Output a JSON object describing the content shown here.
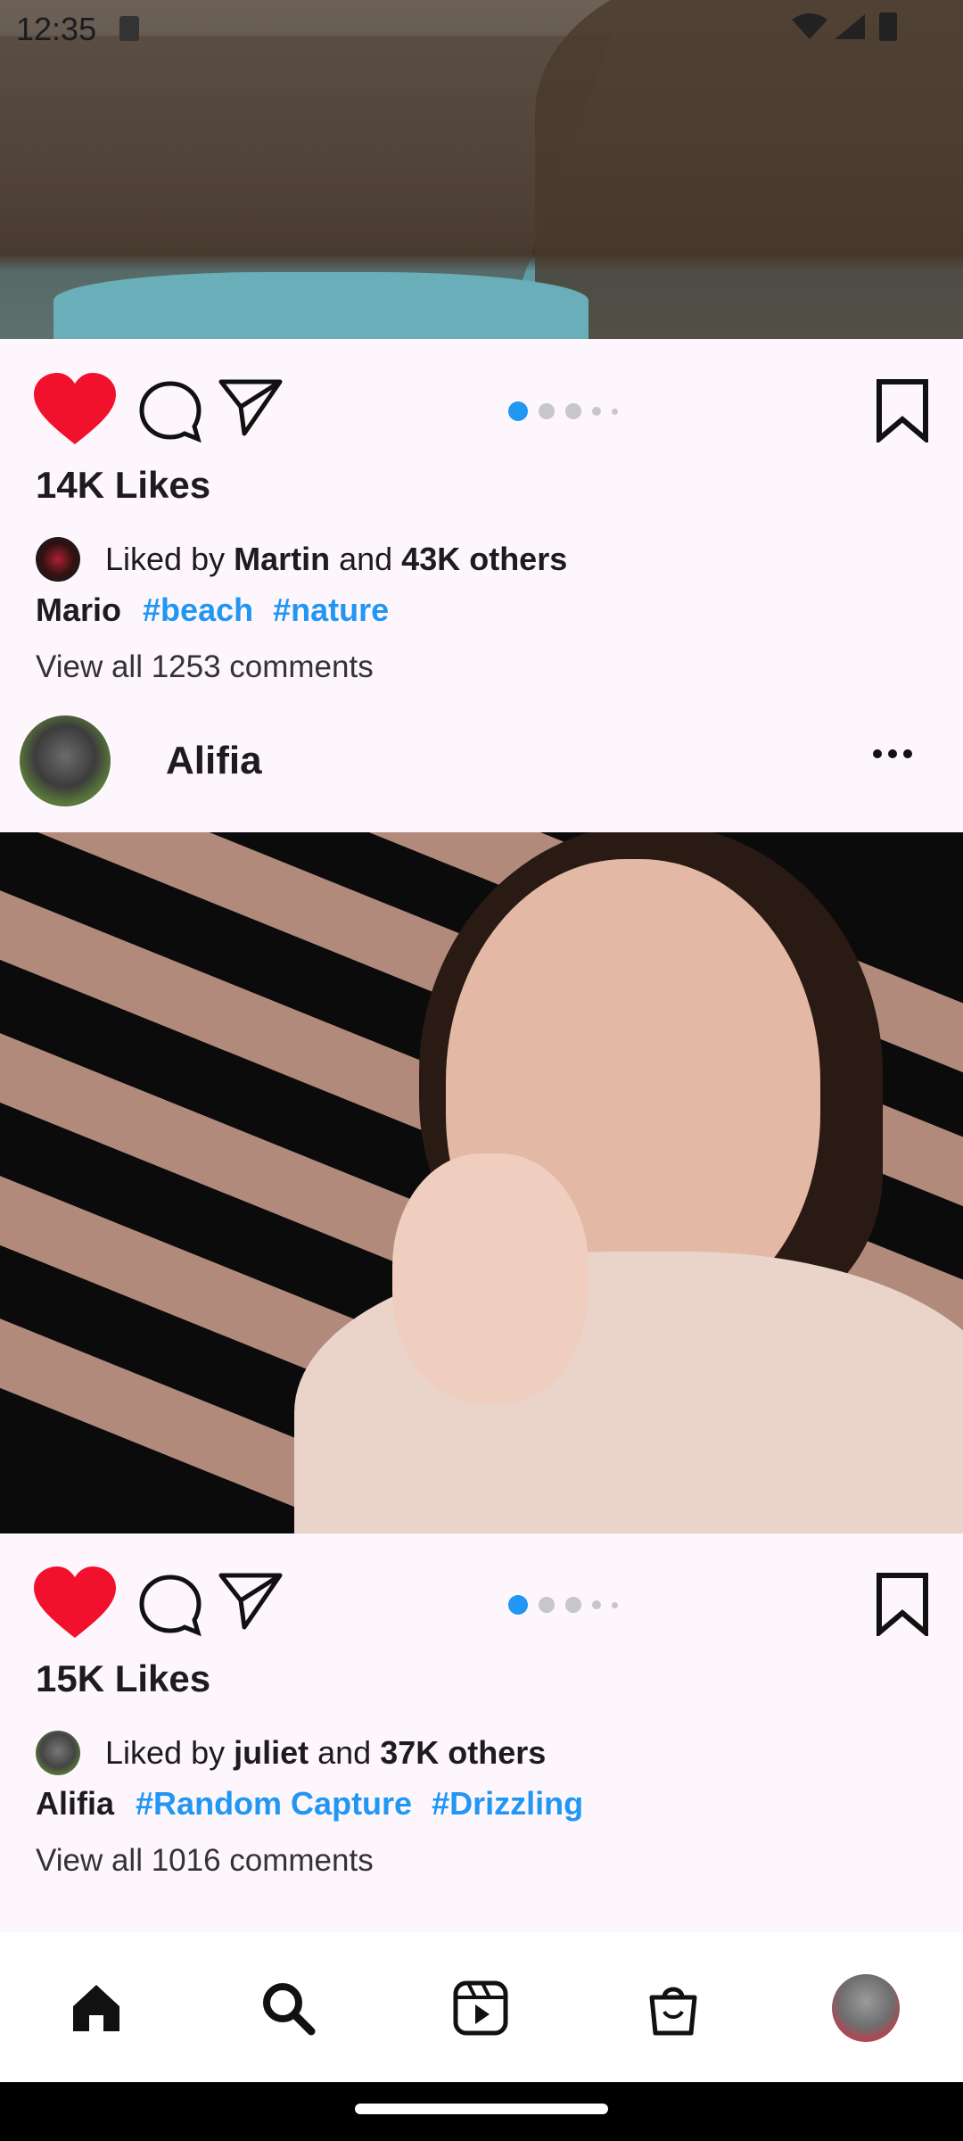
{
  "status_bar": {
    "time": "12:35"
  },
  "posts": [
    {
      "likes": "14K Likes",
      "liked_by_prefix": "Liked by",
      "liked_by_user": "Martin",
      "liked_by_and": "and",
      "liked_by_others": "43K others",
      "caption_user": "Mario",
      "tags": [
        "#beach",
        "#nature"
      ],
      "comments": "View all 1253 comments",
      "carousel": {
        "count": 5,
        "active_index": 0
      }
    },
    {
      "author": "Alifia",
      "likes": "15K Likes",
      "liked_by_prefix": "Liked by",
      "liked_by_user": "juliet",
      "liked_by_and": "and",
      "liked_by_others": "37K others",
      "caption_user": "Alifia",
      "tags": [
        "#Random Capture",
        "#Drizzling"
      ],
      "comments": "View all 1016 comments",
      "carousel": {
        "count": 5,
        "active_index": 0
      }
    }
  ],
  "nav": {
    "items": [
      "home-icon",
      "search-icon",
      "reels-icon",
      "shop-icon",
      "profile-avatar"
    ],
    "active": "home"
  },
  "colors": {
    "background": "#fdf6fc",
    "heart": "#f2112d",
    "accent": "#2196f3",
    "text": "#1c1b1f"
  }
}
